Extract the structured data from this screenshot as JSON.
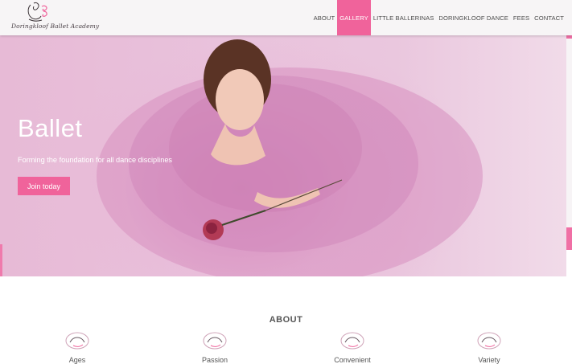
{
  "header": {
    "logo_text": "Doringkloof Ballet Academy",
    "nav": [
      {
        "label": "ABOUT",
        "active": false
      },
      {
        "label": "GALLERY",
        "active": true
      },
      {
        "label": "LITTLE BALLERINAS",
        "active": false
      },
      {
        "label": "DORINGKLOOF DANCE",
        "active": false
      },
      {
        "label": "FEES",
        "active": false
      },
      {
        "label": "CONTACT",
        "active": false
      }
    ]
  },
  "hero": {
    "title": "Ballet",
    "subtitle": "Forming the foundation for all dance disciplines",
    "cta_label": "Join today"
  },
  "about": {
    "title": "ABOUT",
    "features": [
      {
        "label": "Ages"
      },
      {
        "label": "Passion"
      },
      {
        "label": "Convenient"
      },
      {
        "label": "Variety"
      }
    ]
  },
  "colors": {
    "accent": "#f0639b",
    "hero_tint": "#e7bad6",
    "text": "#555555"
  }
}
